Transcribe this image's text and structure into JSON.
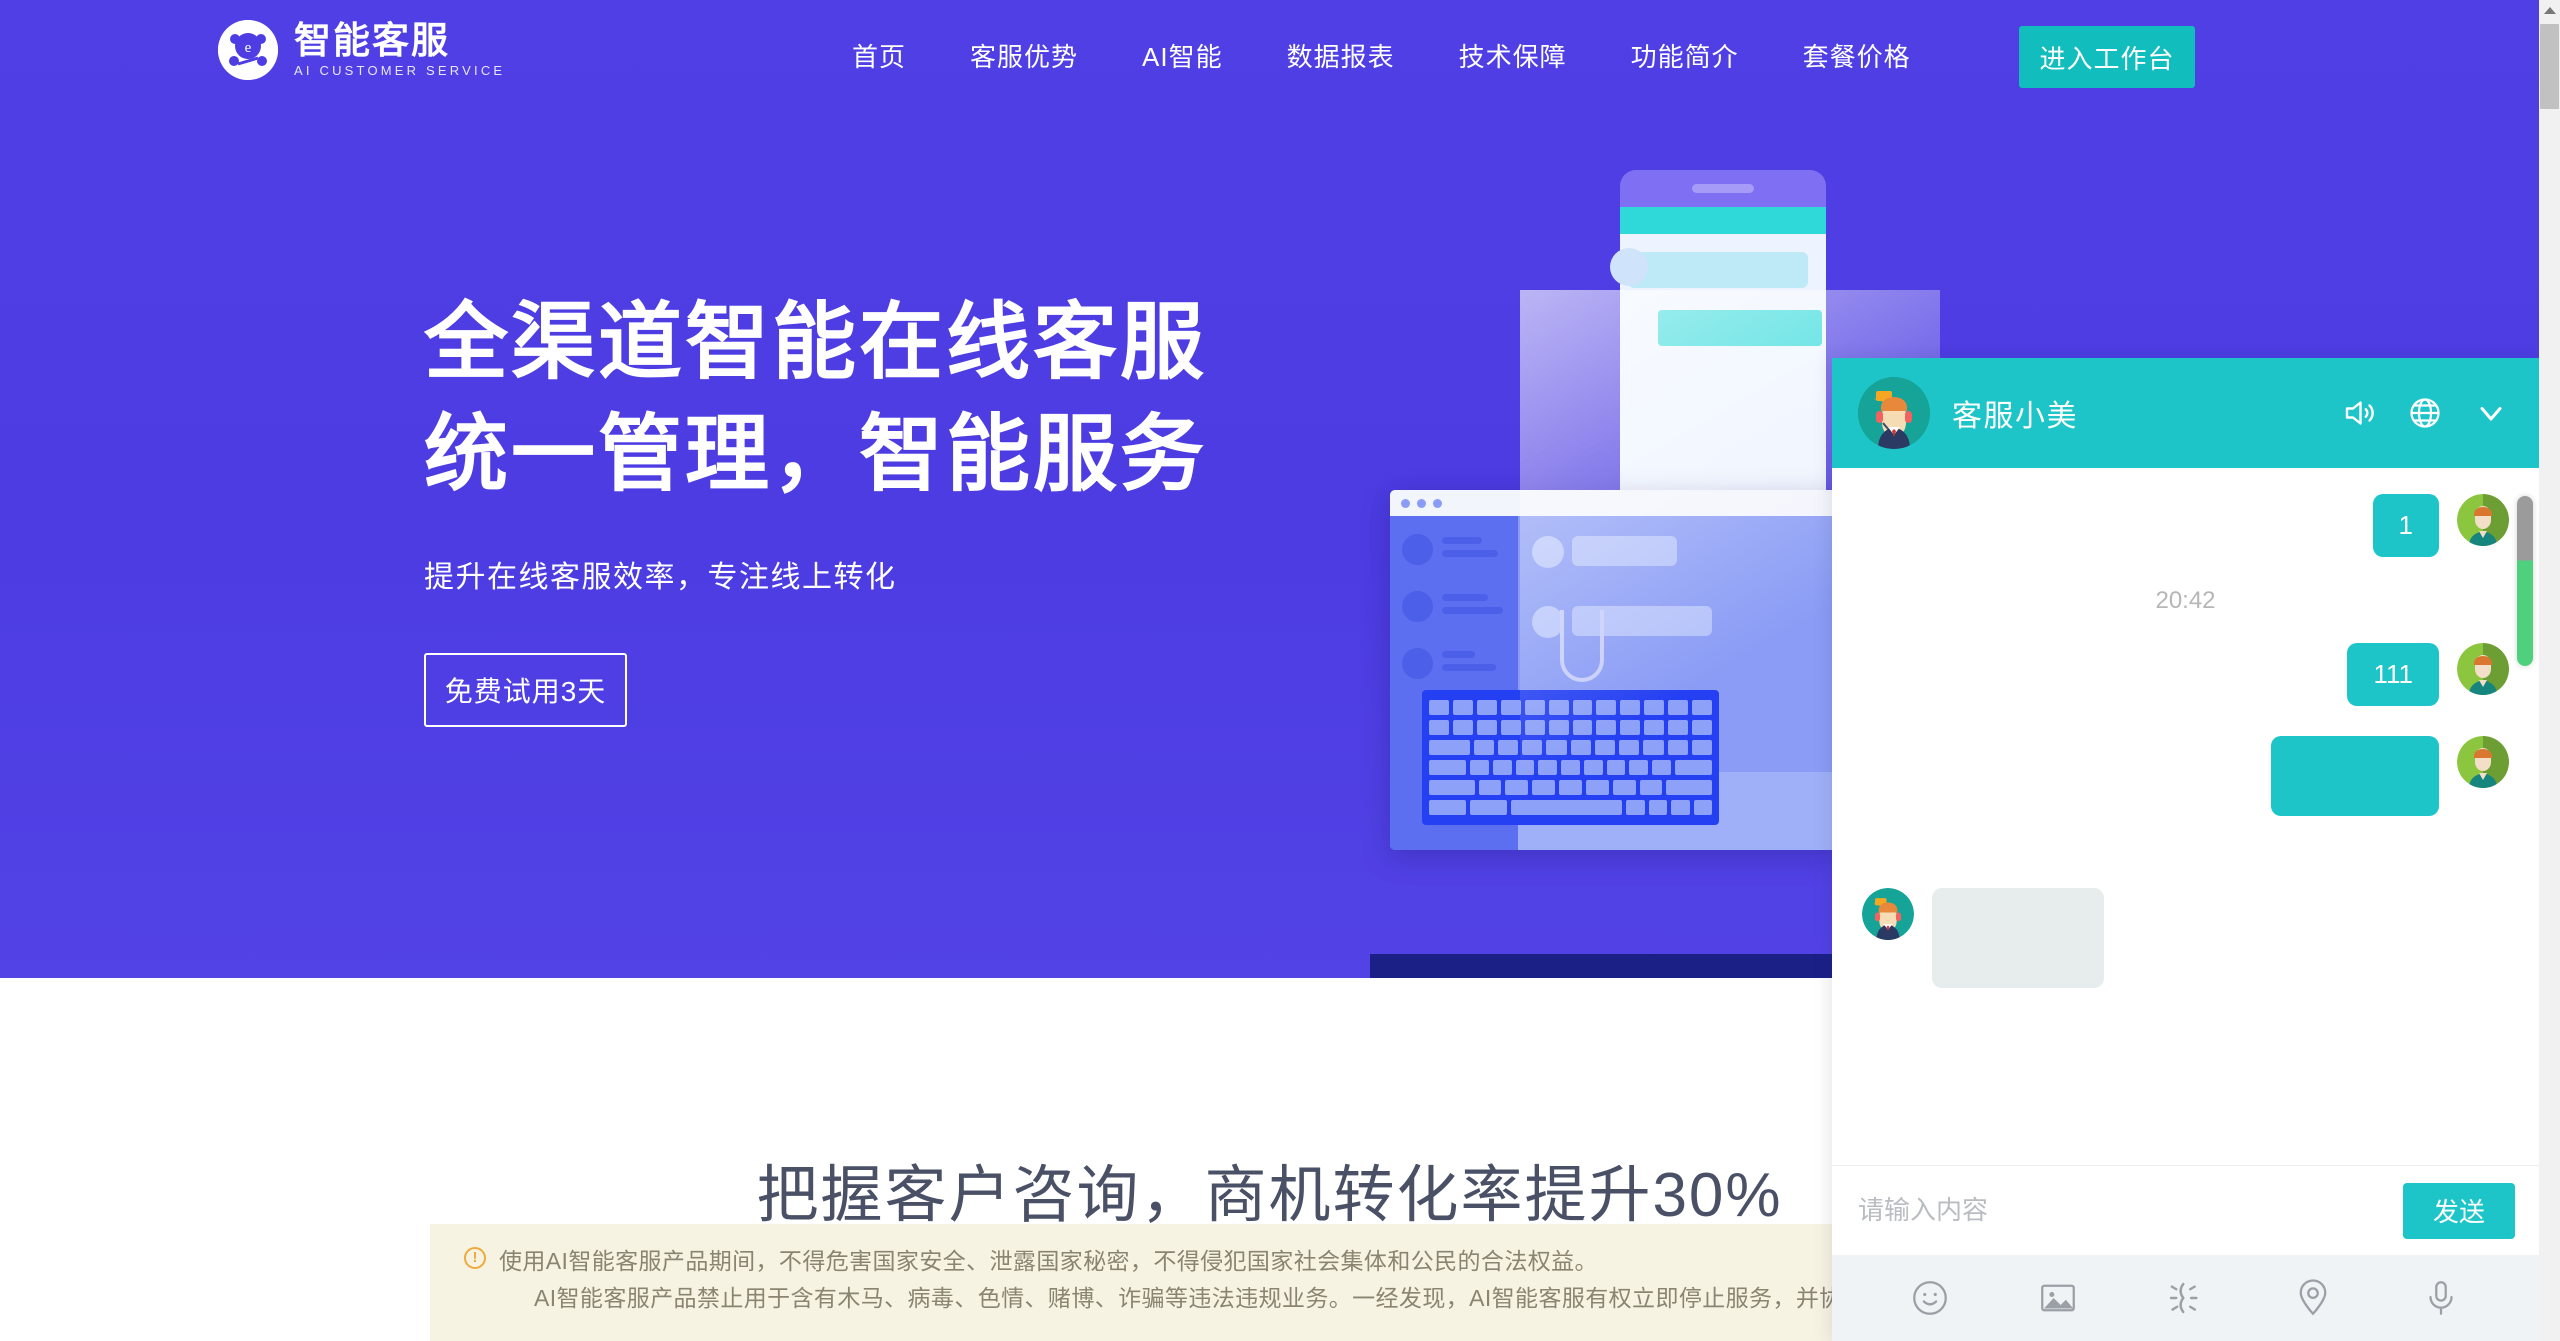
{
  "brand": {
    "name_cn": "智能客服",
    "name_en": "AI CUSTOMER SERVICE"
  },
  "nav": {
    "items": [
      {
        "label": "首页"
      },
      {
        "label": "客服优势"
      },
      {
        "label": "AI智能"
      },
      {
        "label": "数据报表"
      },
      {
        "label": "技术保障"
      },
      {
        "label": "功能简介"
      },
      {
        "label": "套餐价格"
      }
    ],
    "cta_label": "进入工作台",
    "cta_color": "#12bdbd"
  },
  "hero": {
    "title_line1": "全渠道智能在线客服",
    "title_line2": "统一管理，智能服务",
    "subtitle": "提升在线客服效率，专注线上转化",
    "button_label": "免费试用3天",
    "background_color": "#4d3de3"
  },
  "section2": {
    "title": "把握客户咨询，商机转化率提升30%"
  },
  "notice": {
    "icon": "warning-circle-icon",
    "line1": "使用AI智能客服产品期间，不得危害国家安全、泄露国家秘密，不得侵犯国家社会集体和公民的合法权益。",
    "line2": "AI智能客服产品禁止用于含有木马、病毒、色情、赌博、诈骗等违法违规业务。一经发现，AI智能客服有权立即停止服务，并协助相关",
    "background_color": "#f6f3e3"
  },
  "chat": {
    "header": {
      "title": "客服小美",
      "avatar": "agent-avatar",
      "accent_color": "#1ec5c8",
      "icons": [
        {
          "name": "sound-icon"
        },
        {
          "name": "globe-icon"
        },
        {
          "name": "chevron-down-icon"
        }
      ]
    },
    "messages": [
      {
        "id": "m1",
        "direction": "out",
        "text": "1",
        "avatar": "user-avatar"
      },
      {
        "id": "sep1",
        "direction": "separator",
        "text": "20:42"
      },
      {
        "id": "m2",
        "direction": "out",
        "text": "111",
        "avatar": "user-avatar"
      },
      {
        "id": "m3",
        "direction": "out",
        "text": "",
        "avatar": "user-avatar"
      },
      {
        "id": "m4",
        "direction": "in",
        "text": "",
        "avatar": "agent-avatar"
      }
    ],
    "input": {
      "placeholder": "请输入内容",
      "value": "",
      "send_label": "发送"
    },
    "tools": [
      {
        "name": "emoji-icon"
      },
      {
        "name": "image-icon"
      },
      {
        "name": "shake-icon"
      },
      {
        "name": "location-icon"
      },
      {
        "name": "microphone-icon"
      }
    ]
  },
  "scrollbars": {
    "page_thumb_color": "#c1c1c1",
    "widget_thumb_color": "#4fd07c"
  }
}
